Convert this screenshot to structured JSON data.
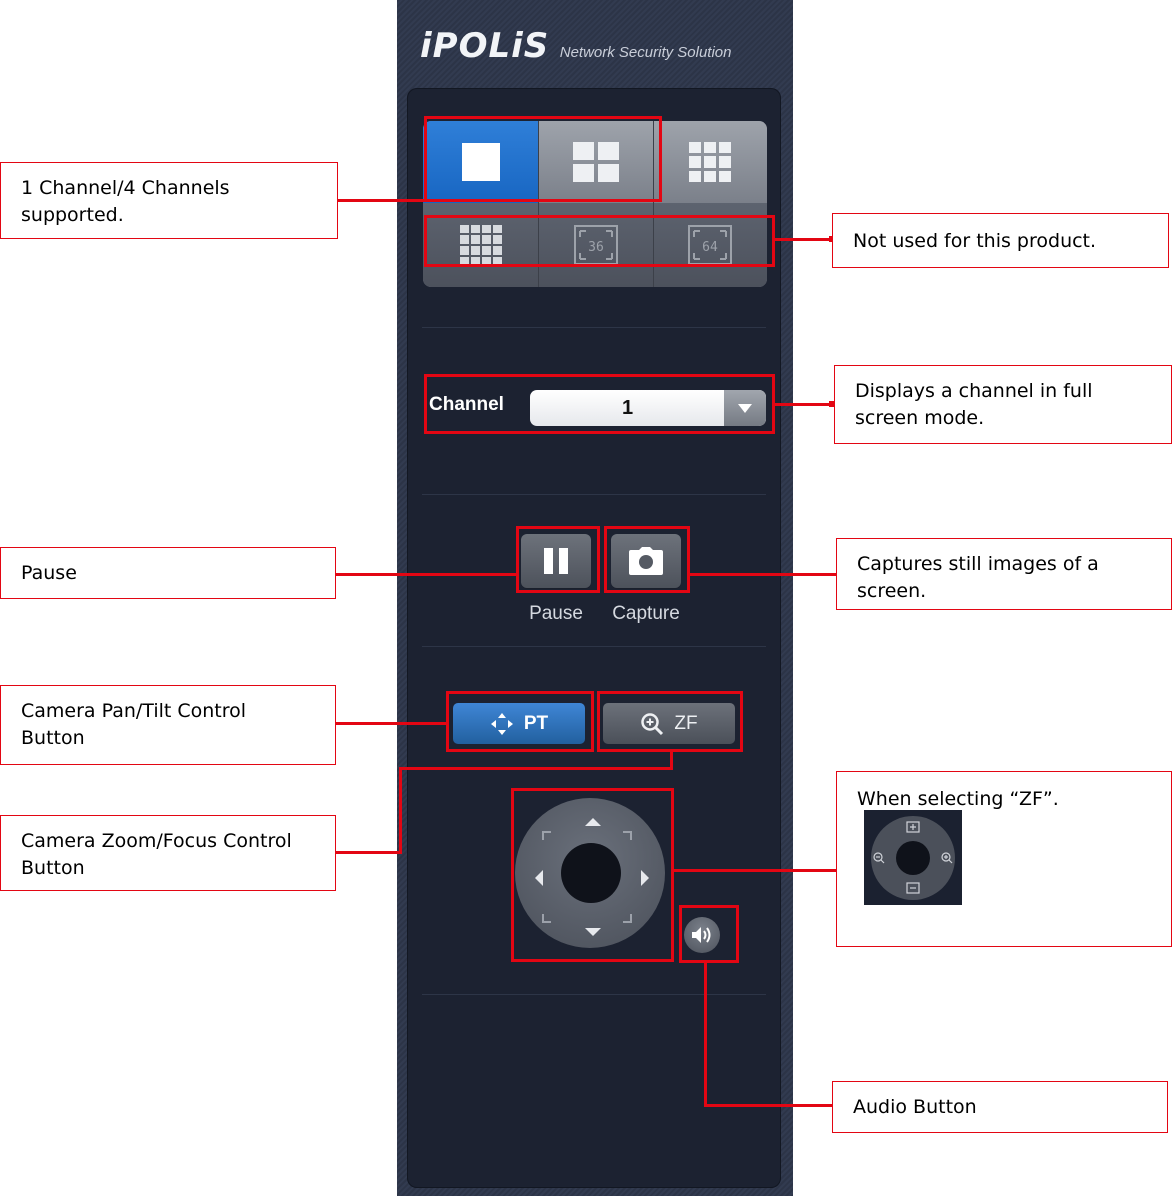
{
  "app": {
    "brand": "iPOLiS",
    "tagline": "Network Security Solution"
  },
  "layout_buttons": [
    {
      "name": "1-channel",
      "selected": true
    },
    {
      "name": "4-channel",
      "selected": false
    },
    {
      "name": "9-channel",
      "selected": false
    },
    {
      "name": "16-channel",
      "selected": false
    },
    {
      "name": "36-channel",
      "label": "36",
      "selected": false
    },
    {
      "name": "64-channel",
      "label": "64",
      "selected": false
    }
  ],
  "channel": {
    "label": "Channel",
    "value": "1"
  },
  "controls": {
    "pause_label": "Pause",
    "capture_label": "Capture",
    "pt_label": "PT",
    "zf_label": "ZF"
  },
  "annotations": {
    "layout": "1 Channel/4 Channels supported.",
    "not_used": "Not used for this product.",
    "fullscreen": "Displays a channel in full screen mode.",
    "pause": "Pause",
    "capture": "Captures still images of a screen.",
    "pan_tilt": "Camera Pan/Tilt Control Button",
    "zoom_focus": "Camera Zoom/Focus Control Button",
    "zf_select": "When selecting “ZF”.",
    "audio": "Audio Button"
  },
  "colors": {
    "accent_blue": "#1866c2",
    "annotation_red": "#e30613",
    "panel_bg": "#2c3447"
  }
}
